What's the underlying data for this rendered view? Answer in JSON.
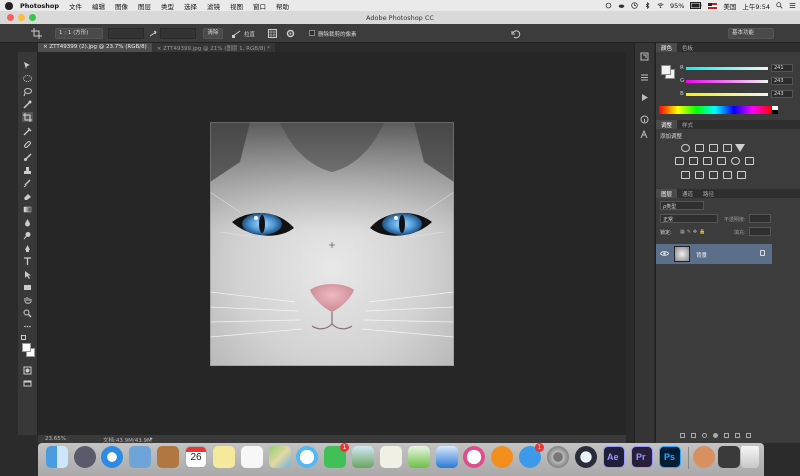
{
  "menubar": {
    "app_name": "Photoshop",
    "items": [
      "文件",
      "编辑",
      "图像",
      "图层",
      "类型",
      "选择",
      "滤镜",
      "视图",
      "窗口",
      "帮助"
    ],
    "battery": "95%",
    "input_method": "美国",
    "clock": "上午9:54"
  },
  "window": {
    "title": "Adobe Photoshop CC"
  },
  "options": {
    "ratio_label": "1 : 1 (方形)",
    "clear_label": "清除",
    "straighten_label": "拉直",
    "delete_pixels_label": "删除裁剪的像素",
    "workspace_label": "基本功能"
  },
  "tabs": [
    {
      "label": "ZTT49399 (2).jpg @ 23.7% (RGB/8)"
    },
    {
      "label": "ZTT49399.jpg @ 21% (图层 1, RGB/8) *"
    }
  ],
  "status": {
    "zoom": "23.65%",
    "doc_size": "文档:43.9M/43.9M"
  },
  "color_panel": {
    "tabs": [
      "颜色",
      "色板"
    ],
    "channels": [
      {
        "label": "R",
        "value": "241"
      },
      {
        "label": "G",
        "value": "243"
      },
      {
        "label": "B",
        "value": "243"
      }
    ]
  },
  "adjustments_panel": {
    "tabs": [
      "调整",
      "样式"
    ],
    "heading": "添加调整"
  },
  "layers_panel": {
    "tabs": [
      "图层",
      "通道",
      "路径"
    ],
    "kind_label": "ρ类型",
    "blend_mode": "正常",
    "opacity_label": "不透明度:",
    "lock_label": "锁定:",
    "fill_label": "填充:",
    "layer_name": "背景"
  },
  "dock": {
    "calendar_day": "26",
    "apps": [
      "finder",
      "launchpad",
      "safari",
      "photos-preview",
      "contacts",
      "calendar",
      "notes",
      "reminders",
      "maps",
      "messages",
      "facetime",
      "photos",
      "ibooks-note",
      "numbers",
      "keynote",
      "itunes",
      "ibooks",
      "app-store",
      "system-preferences",
      "quicktime",
      "after-effects",
      "premiere",
      "photoshop",
      "user-folder",
      "media-folder",
      "trash"
    ],
    "ae_label": "Ae",
    "pr_label": "Pr",
    "ps_label": "Ps",
    "badge_messages": "1",
    "badge_appstore": "1"
  },
  "colors": {
    "ps_blue": "#31a8ff",
    "ae_purple": "#9999ff",
    "pr_purple": "#9999ff",
    "panel_bg": "#3c3c3c",
    "canvas_bg": "#262626",
    "selected_layer": "#5b6f8b"
  }
}
